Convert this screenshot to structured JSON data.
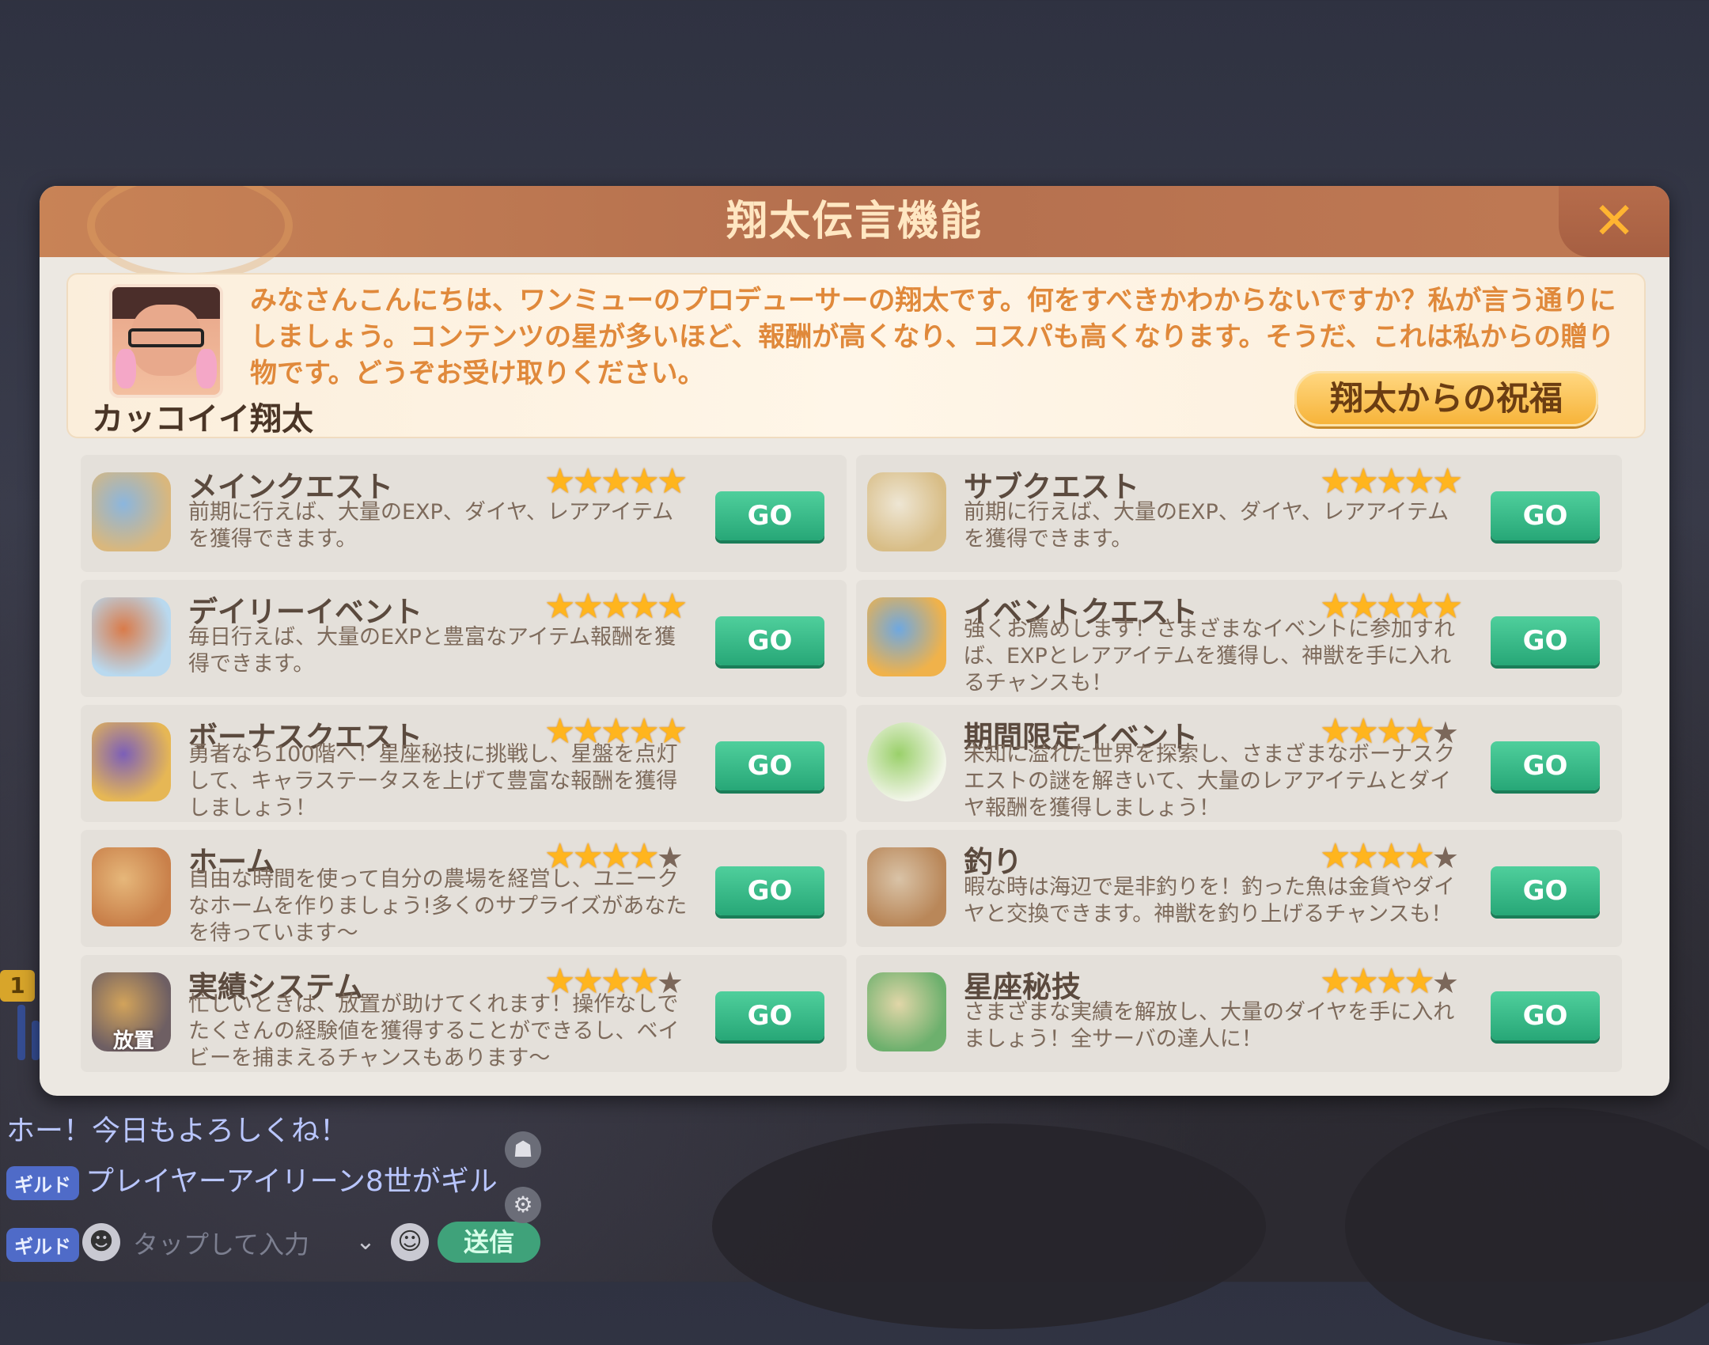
{
  "dialog": {
    "title": "翔太伝言機能",
    "close_glyph": "✕"
  },
  "intro": {
    "npc_name": "カッコイイ翔太",
    "text": "みなさんこんにちは、ワンミューのプロデューサーの翔太です。何をすべきかわからないですか？私が言う通りにしましょう。コンテンツの星が多いほど、報酬が高くなり、コスパも高くなります。そうだ、これは私からの贈り物です。どうぞお受け取りください。",
    "bless_button": "翔太からの祝福"
  },
  "go_label": "GO",
  "star_glyph": "★",
  "quests": [
    {
      "title": "メインクエスト",
      "desc": "前期に行えば、大量のEXP、ダイヤ、レアアイテムを獲得できます。",
      "stars": 5,
      "icon": "scroll-quill-icon"
    },
    {
      "title": "サブクエスト",
      "desc": "前期に行えば、大量のEXP、ダイヤ、レアアイテムを獲得できます。",
      "stars": 5,
      "icon": "map-quill-icon"
    },
    {
      "title": "デイリーイベント",
      "desc": "毎日行えば、大量のEXPと豊富なアイテム報酬を獲得できます。",
      "stars": 5,
      "icon": "compass-icon"
    },
    {
      "title": "イベントクエスト",
      "desc": "強くお薦めします！さまざまなイベントに参加すれば、EXPとレアアイテムを獲得し、神獣を手に入れるチャンスも！",
      "stars": 5,
      "icon": "event-emblem-icon"
    },
    {
      "title": "ボーナスクエスト",
      "desc": "勇者なら100階へ！星座秘技に挑戦し、星盤を点灯して、キャラステータスを上げて豊富な報酬を獲得しましょう！",
      "stars": 5,
      "icon": "astrolabe-icon"
    },
    {
      "title": "期間限定イベント",
      "desc": "未知に溢れた世界を探索し、さまざまなボーナスクエストの謎を解きいて、大量のレアアイテムとダイヤ報酬を獲得しましょう！",
      "stars": 4,
      "icon": "egg-icon"
    },
    {
      "title": "ホーム",
      "desc": "自由な時間を使って自分の農場を経営し、ユニークなホームを作りましょう!多くのサプライズがあなたを待っています〜",
      "stars": 4,
      "icon": "house-icon"
    },
    {
      "title": "釣り",
      "desc": "暇な時は海辺で是非釣りを！釣った魚は金貨やダイヤと交換できます。神獣を釣り上げるチャンスも！",
      "stars": 4,
      "icon": "fishing-rod-icon"
    },
    {
      "title": "実績システム",
      "desc": "忙しいときは、放置が助けてくれます！操作なしでたくさんの経験値を獲得することができるし、ベイビーを捕まえるチャンスもあります〜",
      "stars": 4,
      "icon": "idle-hexagon-icon",
      "icon_label": "放置"
    },
    {
      "title": "星座秘技",
      "desc": "さまざまな実績を解放し、大量のダイヤを手に入れましょう！全サーバの達人に！",
      "stars": 4,
      "icon": "book-quill-icon"
    }
  ],
  "chat": {
    "line1_tag": "ギルド",
    "line1_text": "ホー！今日もよろしくね！",
    "line2_tag": "ギルド",
    "line2_text": "プレイヤーアイリーン8世がギル",
    "input_tag": "ギルド",
    "placeholder": "タップして入力",
    "send_label": "送信",
    "level_badge": "1"
  },
  "colors": {
    "title_bar": "#b46f4e",
    "star_filled": "#ffb51e",
    "go_button": "#27a777",
    "intro_text": "#e0893b"
  }
}
